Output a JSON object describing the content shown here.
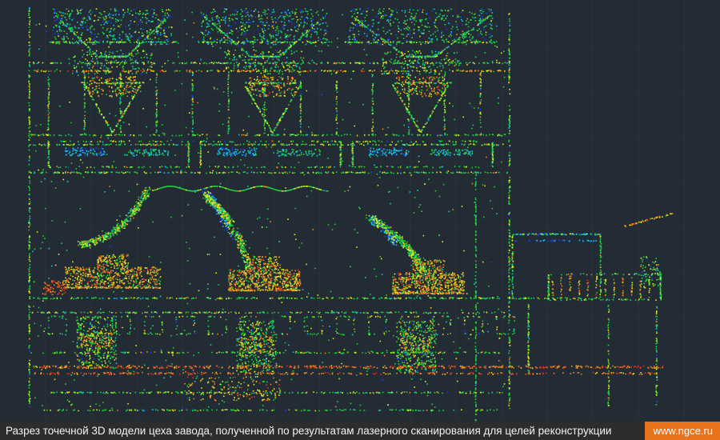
{
  "image": {
    "subject": "point-cloud-section",
    "palette": {
      "background": "#232b35",
      "grid": "#34404c",
      "low": "#1f3cff",
      "cyan": "#14c8e6",
      "green": "#22d23a",
      "yellow": "#e8e820",
      "orange": "#f08a1c",
      "red": "#e0301c"
    }
  },
  "caption": {
    "text": "Разрез точечной 3D модели цеха завода, полученной по результатам лазерного сканирования для целей реконструкции",
    "site": "www.ngce.ru",
    "background": "#2d2d2d",
    "badge_color": "#e8731c"
  }
}
